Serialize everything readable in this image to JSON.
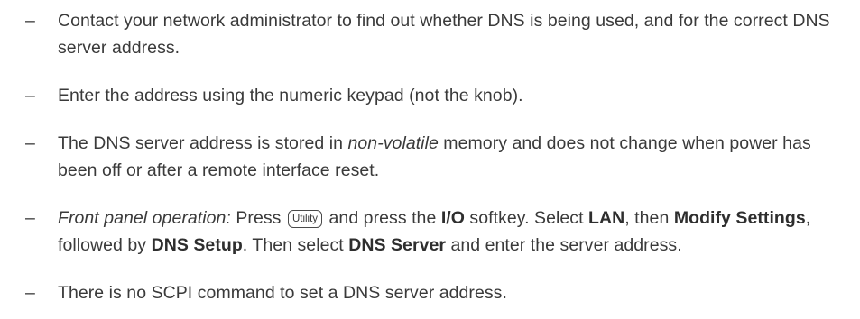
{
  "bullets": [
    {
      "dash": "–",
      "text": "Contact your network administrator to find out whether DNS is being used, and for the correct DNS server address."
    },
    {
      "dash": "–",
      "text": "Enter the address using the numeric keypad (not the knob)."
    },
    {
      "dash": "–",
      "pre": "The DNS server address is stored in ",
      "italic": "non-volatile",
      "post": " memory and does not change when power has been off or after a remote interface reset."
    },
    {
      "dash": "–",
      "lead_italic": "Front panel operation:",
      "press_text": " Press ",
      "key_label": "Utility",
      "mid1": " and press the ",
      "softkey": "I/O",
      "mid2": " softkey. Select ",
      "lan": "LAN",
      "mid3": ", then ",
      "modify": "Modify Settings",
      "mid4": ", followed by ",
      "dns_setup": "DNS Setup",
      "mid5": ". Then select ",
      "dns_server": "DNS Server",
      "tail": " and enter the server address."
    },
    {
      "dash": "–",
      "text": "There is no SCPI command to set a DNS server address."
    }
  ]
}
